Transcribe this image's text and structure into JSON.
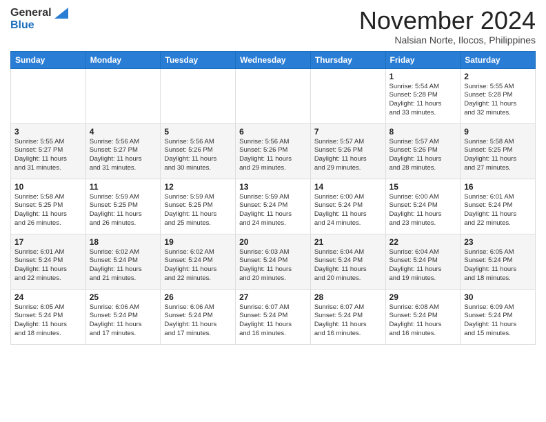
{
  "header": {
    "logo_line1": "General",
    "logo_line2": "Blue",
    "month_title": "November 2024",
    "location": "Nalsian Norte, Ilocos, Philippines"
  },
  "calendar": {
    "weekdays": [
      "Sunday",
      "Monday",
      "Tuesday",
      "Wednesday",
      "Thursday",
      "Friday",
      "Saturday"
    ],
    "weeks": [
      [
        {
          "day": "",
          "text": ""
        },
        {
          "day": "",
          "text": ""
        },
        {
          "day": "",
          "text": ""
        },
        {
          "day": "",
          "text": ""
        },
        {
          "day": "",
          "text": ""
        },
        {
          "day": "1",
          "text": "Sunrise: 5:54 AM\nSunset: 5:28 PM\nDaylight: 11 hours\nand 33 minutes."
        },
        {
          "day": "2",
          "text": "Sunrise: 5:55 AM\nSunset: 5:28 PM\nDaylight: 11 hours\nand 32 minutes."
        }
      ],
      [
        {
          "day": "3",
          "text": "Sunrise: 5:55 AM\nSunset: 5:27 PM\nDaylight: 11 hours\nand 31 minutes."
        },
        {
          "day": "4",
          "text": "Sunrise: 5:56 AM\nSunset: 5:27 PM\nDaylight: 11 hours\nand 31 minutes."
        },
        {
          "day": "5",
          "text": "Sunrise: 5:56 AM\nSunset: 5:26 PM\nDaylight: 11 hours\nand 30 minutes."
        },
        {
          "day": "6",
          "text": "Sunrise: 5:56 AM\nSunset: 5:26 PM\nDaylight: 11 hours\nand 29 minutes."
        },
        {
          "day": "7",
          "text": "Sunrise: 5:57 AM\nSunset: 5:26 PM\nDaylight: 11 hours\nand 29 minutes."
        },
        {
          "day": "8",
          "text": "Sunrise: 5:57 AM\nSunset: 5:26 PM\nDaylight: 11 hours\nand 28 minutes."
        },
        {
          "day": "9",
          "text": "Sunrise: 5:58 AM\nSunset: 5:25 PM\nDaylight: 11 hours\nand 27 minutes."
        }
      ],
      [
        {
          "day": "10",
          "text": "Sunrise: 5:58 AM\nSunset: 5:25 PM\nDaylight: 11 hours\nand 26 minutes."
        },
        {
          "day": "11",
          "text": "Sunrise: 5:59 AM\nSunset: 5:25 PM\nDaylight: 11 hours\nand 26 minutes."
        },
        {
          "day": "12",
          "text": "Sunrise: 5:59 AM\nSunset: 5:25 PM\nDaylight: 11 hours\nand 25 minutes."
        },
        {
          "day": "13",
          "text": "Sunrise: 5:59 AM\nSunset: 5:24 PM\nDaylight: 11 hours\nand 24 minutes."
        },
        {
          "day": "14",
          "text": "Sunrise: 6:00 AM\nSunset: 5:24 PM\nDaylight: 11 hours\nand 24 minutes."
        },
        {
          "day": "15",
          "text": "Sunrise: 6:00 AM\nSunset: 5:24 PM\nDaylight: 11 hours\nand 23 minutes."
        },
        {
          "day": "16",
          "text": "Sunrise: 6:01 AM\nSunset: 5:24 PM\nDaylight: 11 hours\nand 22 minutes."
        }
      ],
      [
        {
          "day": "17",
          "text": "Sunrise: 6:01 AM\nSunset: 5:24 PM\nDaylight: 11 hours\nand 22 minutes."
        },
        {
          "day": "18",
          "text": "Sunrise: 6:02 AM\nSunset: 5:24 PM\nDaylight: 11 hours\nand 21 minutes."
        },
        {
          "day": "19",
          "text": "Sunrise: 6:02 AM\nSunset: 5:24 PM\nDaylight: 11 hours\nand 22 minutes."
        },
        {
          "day": "20",
          "text": "Sunrise: 6:03 AM\nSunset: 5:24 PM\nDaylight: 11 hours\nand 20 minutes."
        },
        {
          "day": "21",
          "text": "Sunrise: 6:04 AM\nSunset: 5:24 PM\nDaylight: 11 hours\nand 20 minutes."
        },
        {
          "day": "22",
          "text": "Sunrise: 6:04 AM\nSunset: 5:24 PM\nDaylight: 11 hours\nand 19 minutes."
        },
        {
          "day": "23",
          "text": "Sunrise: 6:05 AM\nSunset: 5:24 PM\nDaylight: 11 hours\nand 18 minutes."
        }
      ],
      [
        {
          "day": "24",
          "text": "Sunrise: 6:05 AM\nSunset: 5:24 PM\nDaylight: 11 hours\nand 18 minutes."
        },
        {
          "day": "25",
          "text": "Sunrise: 6:06 AM\nSunset: 5:24 PM\nDaylight: 11 hours\nand 17 minutes."
        },
        {
          "day": "26",
          "text": "Sunrise: 6:06 AM\nSunset: 5:24 PM\nDaylight: 11 hours\nand 17 minutes."
        },
        {
          "day": "27",
          "text": "Sunrise: 6:07 AM\nSunset: 5:24 PM\nDaylight: 11 hours\nand 16 minutes."
        },
        {
          "day": "28",
          "text": "Sunrise: 6:07 AM\nSunset: 5:24 PM\nDaylight: 11 hours\nand 16 minutes."
        },
        {
          "day": "29",
          "text": "Sunrise: 6:08 AM\nSunset: 5:24 PM\nDaylight: 11 hours\nand 16 minutes."
        },
        {
          "day": "30",
          "text": "Sunrise: 6:09 AM\nSunset: 5:24 PM\nDaylight: 11 hours\nand 15 minutes."
        }
      ]
    ]
  }
}
